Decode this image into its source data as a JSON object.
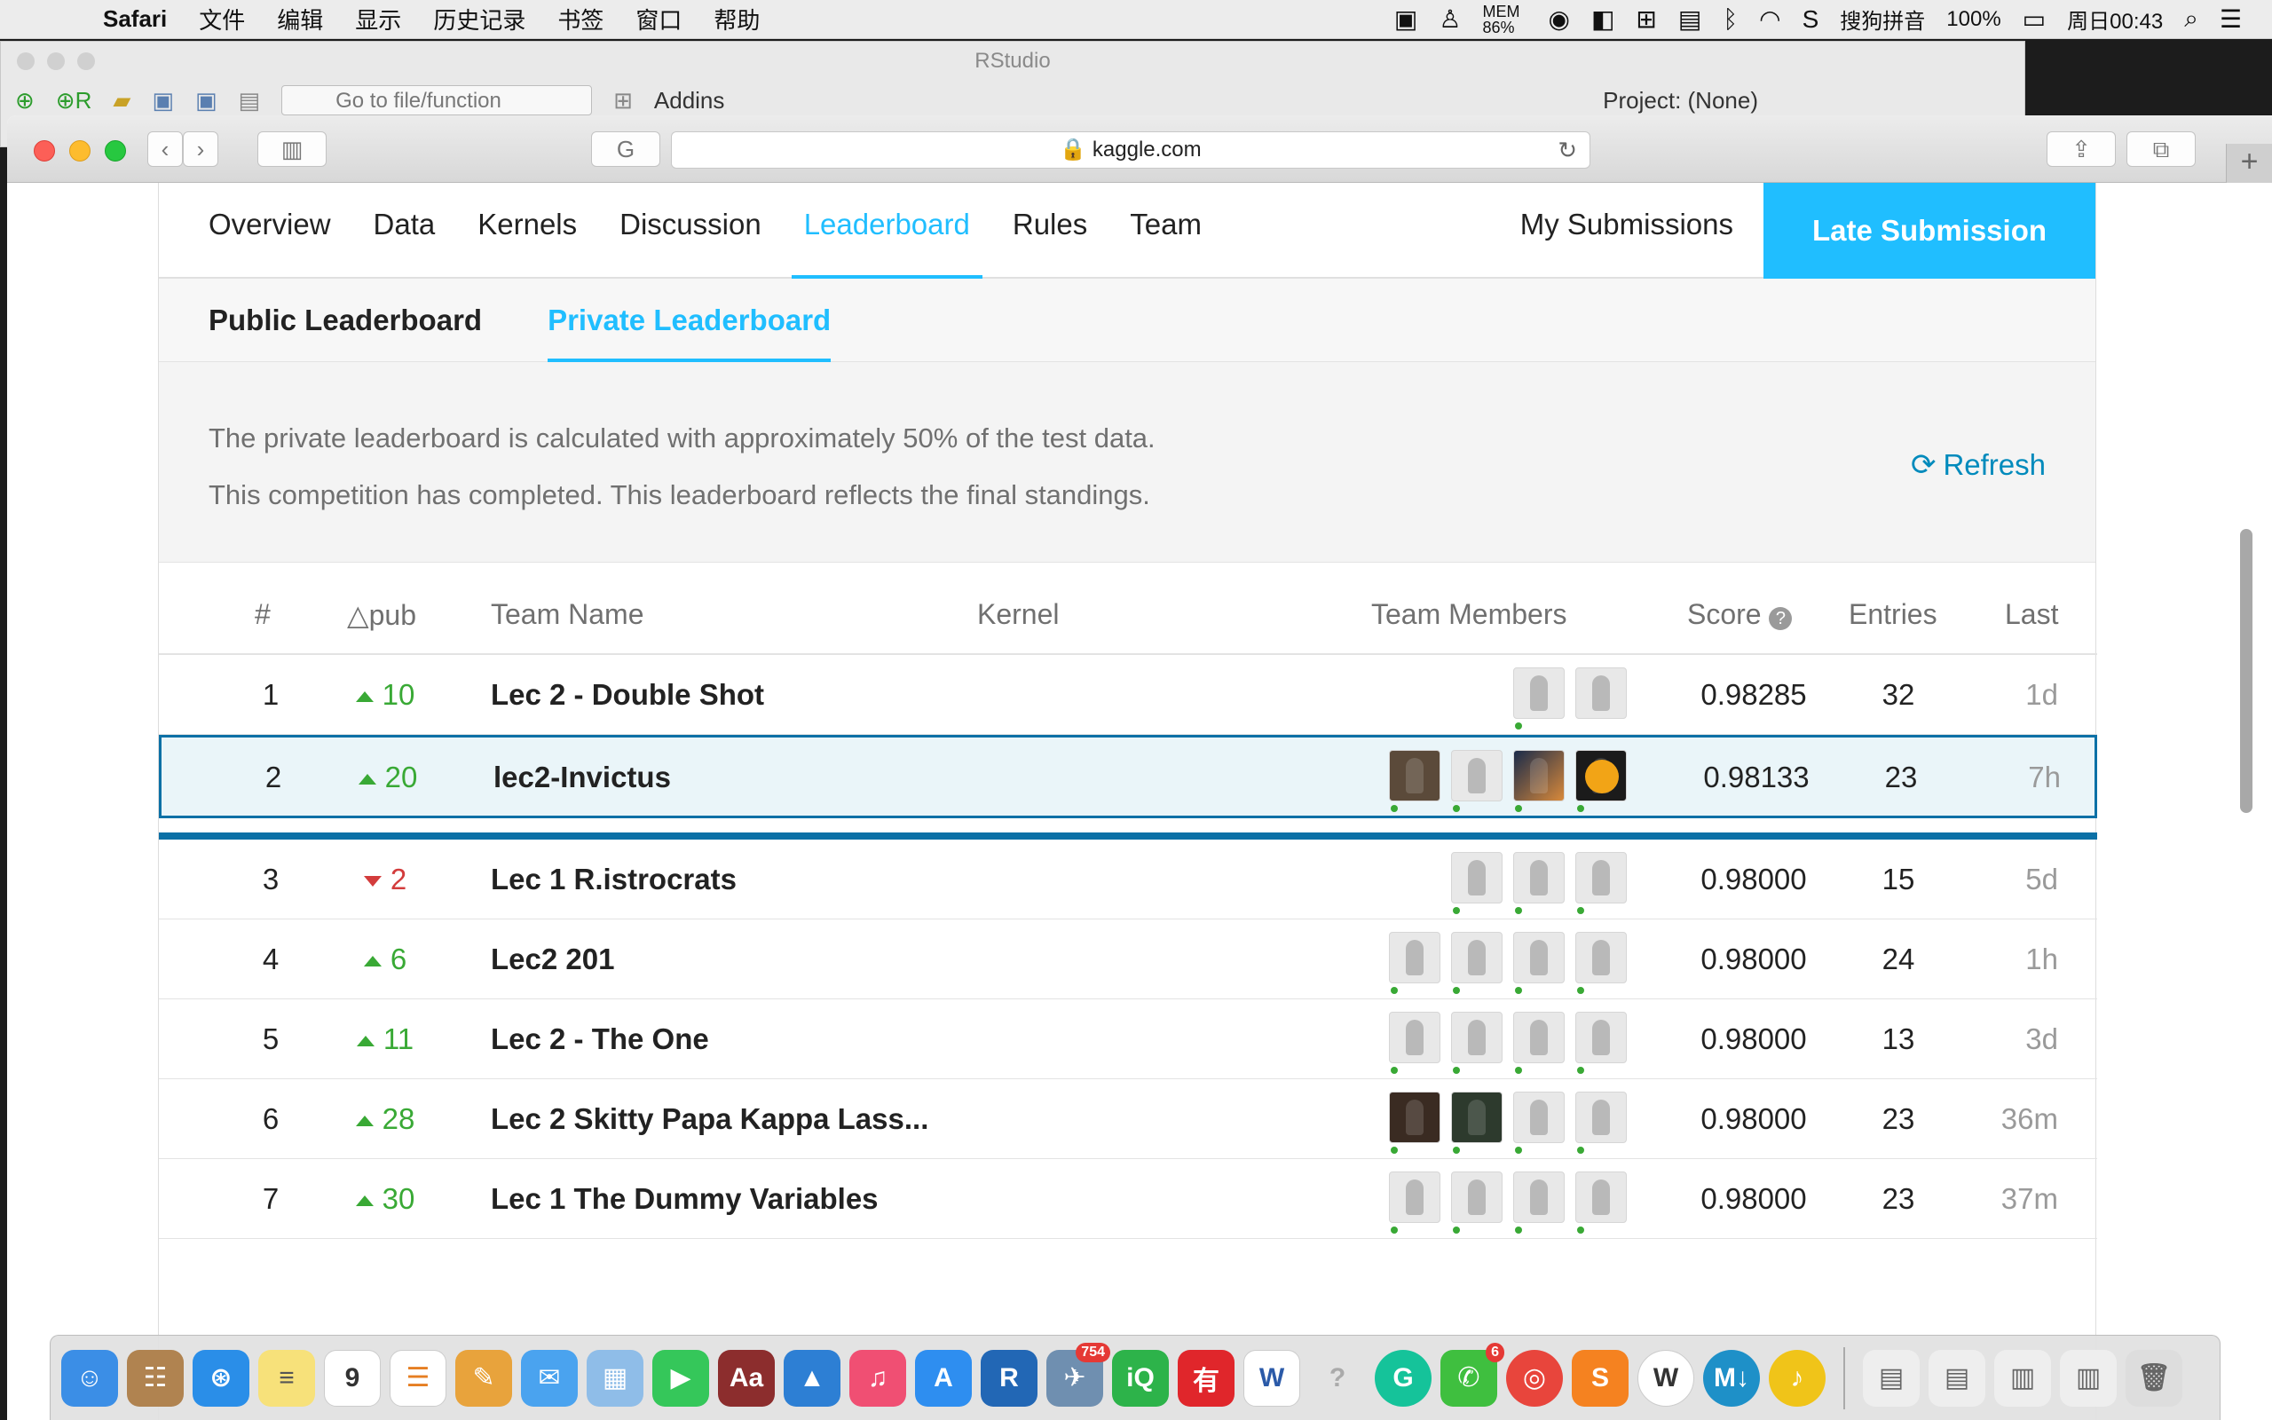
{
  "menubar": {
    "app_name": "Safari",
    "items": [
      "文件",
      "编辑",
      "显示",
      "历史记录",
      "书签",
      "窗口",
      "帮助"
    ],
    "status": {
      "mem": "MEM 86%",
      "input_method": "搜狗拼音",
      "battery": "100%",
      "clock": "周日00:43"
    }
  },
  "rstudio": {
    "title": "RStudio",
    "goto_placeholder": "Go to file/function",
    "addins_label": "Addins",
    "project_label": "Project: (None)"
  },
  "safari": {
    "url": "kaggle.com"
  },
  "competition_nav": {
    "tabs": [
      "Overview",
      "Data",
      "Kernels",
      "Discussion",
      "Leaderboard",
      "Rules",
      "Team"
    ],
    "active_tab": "Leaderboard",
    "my_submissions": "My Submissions",
    "late_submission": "Late Submission"
  },
  "leaderboard_tabs": {
    "public": "Public Leaderboard",
    "private": "Private Leaderboard"
  },
  "info": {
    "line1": "The private leaderboard is calculated with approximately 50% of the test data.",
    "line2": "This competition has completed. This leaderboard reflects the final standings.",
    "refresh": "Refresh"
  },
  "table": {
    "headers": {
      "rank": "#",
      "delta": "△pub",
      "team_name": "Team Name",
      "kernel": "Kernel",
      "members": "Team Members",
      "score": "Score",
      "entries": "Entries",
      "last": "Last"
    },
    "rows": [
      {
        "rank": "1",
        "delta": "10",
        "direction": "up",
        "team": "Lec 2 - Double Shot",
        "score": "0.98285",
        "entries": "32",
        "last": "1d"
      },
      {
        "rank": "2",
        "delta": "20",
        "direction": "up",
        "team": "lec2-Invictus",
        "score": "0.98133",
        "entries": "23",
        "last": "7h"
      },
      {
        "rank": "3",
        "delta": "2",
        "direction": "down",
        "team": "Lec 1 R.istrocrats",
        "score": "0.98000",
        "entries": "15",
        "last": "5d"
      },
      {
        "rank": "4",
        "delta": "6",
        "direction": "up",
        "team": "Lec2 201",
        "score": "0.98000",
        "entries": "24",
        "last": "1h"
      },
      {
        "rank": "5",
        "delta": "11",
        "direction": "up",
        "team": "Lec 2 - The One",
        "score": "0.98000",
        "entries": "13",
        "last": "3d"
      },
      {
        "rank": "6",
        "delta": "28",
        "direction": "up",
        "team": "Lec 2 Skitty Papa Kappa Lass...",
        "score": "0.98000",
        "entries": "23",
        "last": "36m"
      },
      {
        "rank": "7",
        "delta": "30",
        "direction": "up",
        "team": "Lec 1 The Dummy Variables",
        "score": "0.98000",
        "entries": "23",
        "last": "37m"
      }
    ]
  },
  "dock": {
    "badge_mail": "754",
    "badge_wechat": "6"
  },
  "colors": {
    "accent": "#20beff",
    "highlight_border": "#0b70a6",
    "up": "#39a935",
    "down": "#d33c3c"
  }
}
